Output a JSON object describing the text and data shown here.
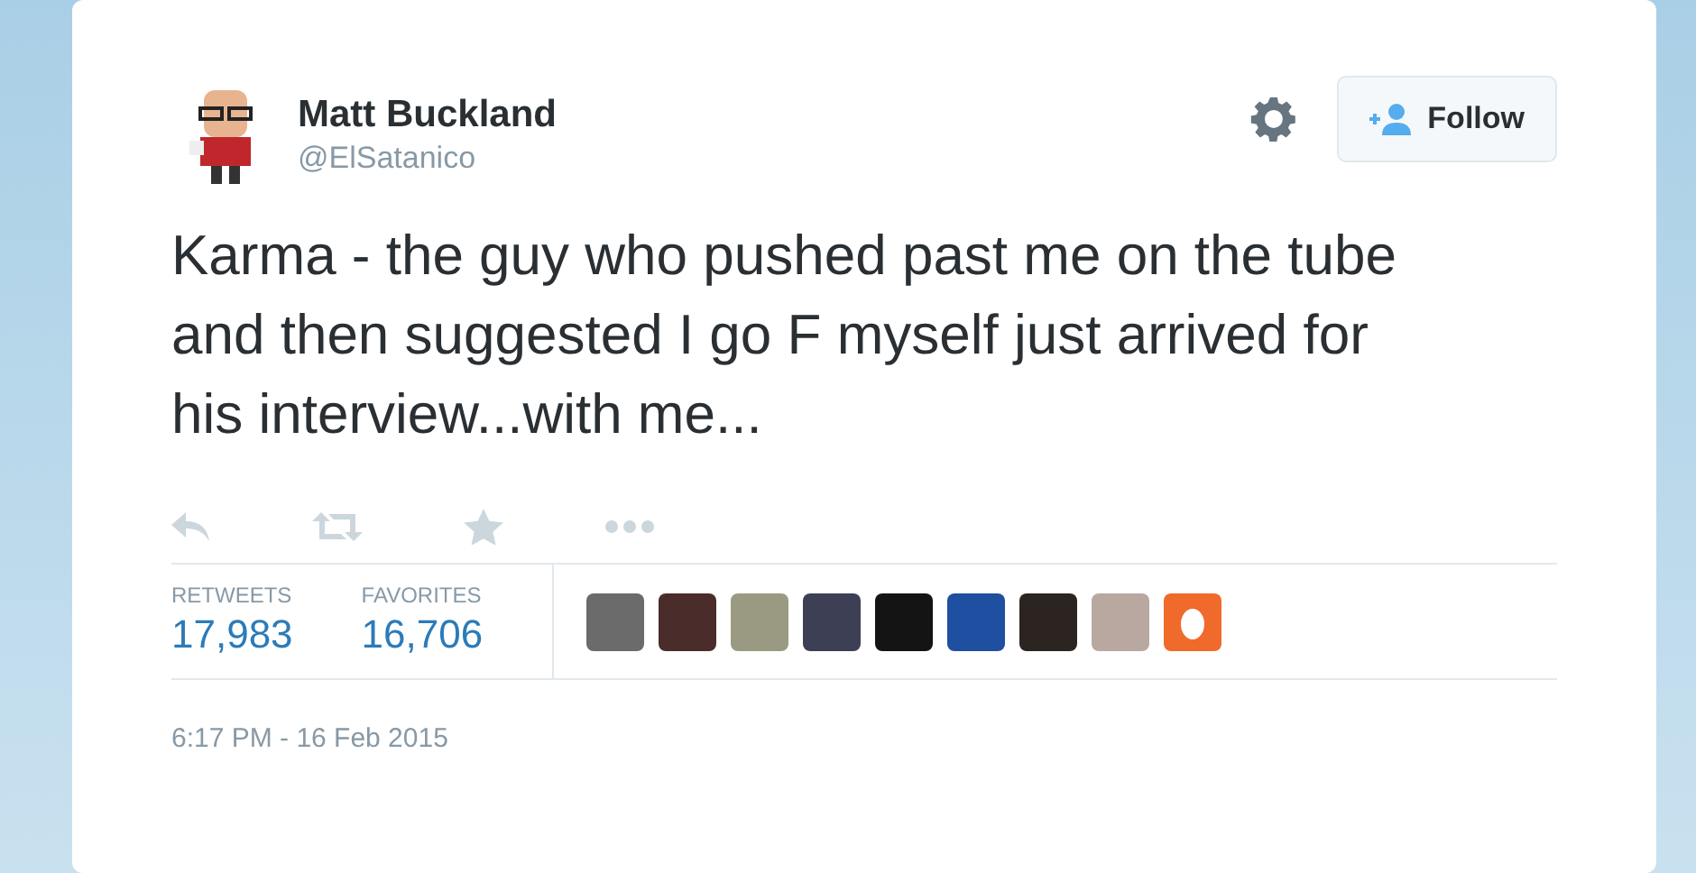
{
  "tweet": {
    "author": {
      "name": "Matt Buckland",
      "handle": "@ElSatanico"
    },
    "follow_button": {
      "label": "Follow"
    },
    "text": "Karma - the guy who pushed past me on the tube and then suggested I go F myself just arrived for his interview...with me...",
    "stats": [
      {
        "label": "RETWEETS",
        "value": "17,983"
      },
      {
        "label": "FAVORITES",
        "value": "16,706"
      }
    ],
    "favoriters": [
      {
        "kind": "photo"
      },
      {
        "kind": "photo"
      },
      {
        "kind": "photo"
      },
      {
        "kind": "photo"
      },
      {
        "kind": "photo"
      },
      {
        "kind": "photo"
      },
      {
        "kind": "photo"
      },
      {
        "kind": "photo"
      },
      {
        "kind": "egg"
      }
    ],
    "timestamp": "6:17 PM - 16 Feb 2015"
  }
}
